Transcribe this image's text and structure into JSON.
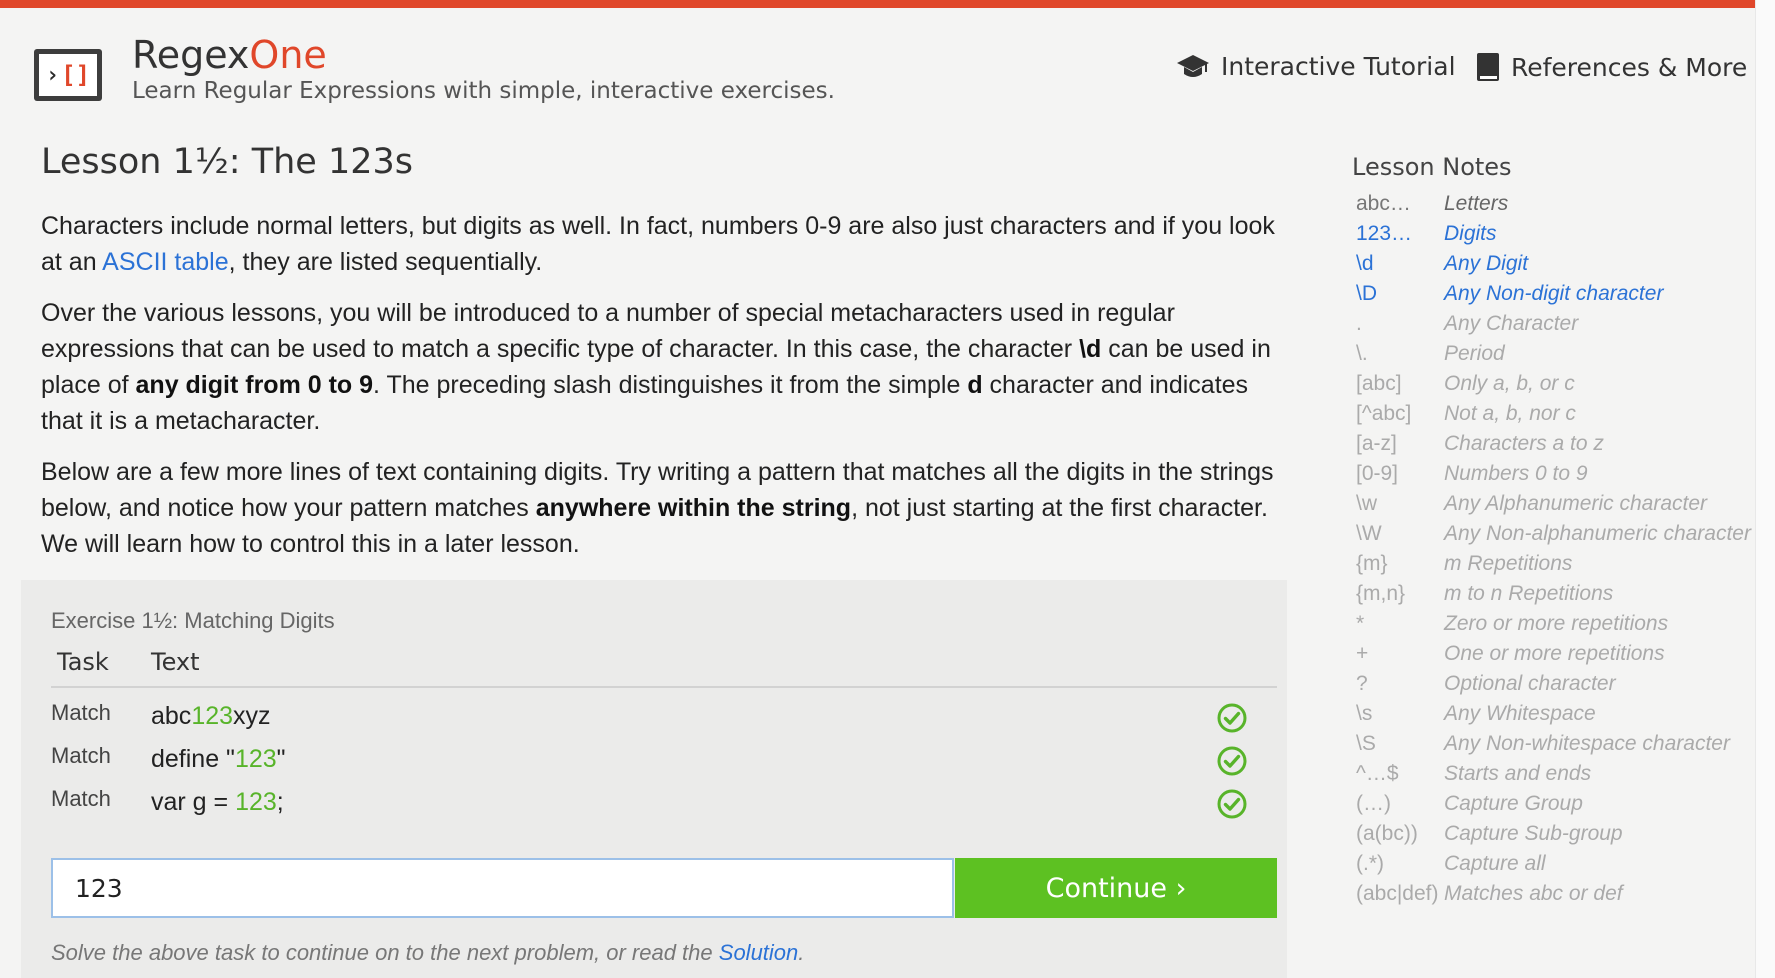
{
  "colors": {
    "accent": "#e0472a",
    "link": "#2b72d6",
    "success": "#5dc122",
    "match_text": "#58b42a"
  },
  "header": {
    "brand_regex": "Regex",
    "brand_one": "One",
    "tagline": "Learn Regular Expressions with simple, interactive exercises.",
    "nav": [
      {
        "label": "Interactive Tutorial",
        "icon": "graduation-cap-icon"
      },
      {
        "label": "References & More",
        "icon": "book-icon"
      }
    ]
  },
  "lesson": {
    "title": "Lesson 1½: The 123s",
    "p1": {
      "a": "Characters include normal letters, but digits as well. In fact, numbers 0-9 are also just characters and if you look at an ",
      "link": "ASCII table",
      "b": ", they are listed sequentially."
    },
    "p2": {
      "a": "Over the various lessons, you will be introduced to a number of special metacharacters used in regular expressions that can be used to match a specific type of character. In this case, the character ",
      "b1": "\\d",
      "b": " can be used in place of ",
      "b2": "any digit from 0 to 9",
      "c": ". The preceding slash distinguishes it from the simple ",
      "b3": "d",
      "d": " character and indicates that it is a metacharacter."
    },
    "p3": {
      "a": "Below are a few more lines of text containing digits. Try writing a pattern that matches all the digits in the strings below, and notice how your pattern matches ",
      "b1": "anywhere within the string",
      "b": ", not just starting at the first character. We will learn how to control this in a later lesson."
    }
  },
  "exercise": {
    "title": "Exercise 1½: Matching Digits",
    "headers": {
      "task": "Task",
      "text": "Text"
    },
    "rows": [
      {
        "task": "Match",
        "pre": "abc",
        "match": "123",
        "post": "xyz",
        "status": "check-circle-icon"
      },
      {
        "task": "Match",
        "pre": "define \"",
        "match": "123",
        "post": "\"",
        "status": "check-circle-icon"
      },
      {
        "task": "Match",
        "pre": "var g = ",
        "match": "123",
        "post": ";",
        "status": "check-circle-icon"
      }
    ],
    "input_value": "123",
    "continue_label": "Continue ›",
    "footnote_pre": "Solve the above task to continue on to the next problem, or read the ",
    "footnote_link": "Solution",
    "footnote_post": "."
  },
  "notes": {
    "title": "Lesson Notes",
    "items": [
      {
        "code": "abc…",
        "desc": "Letters",
        "state": "done"
      },
      {
        "code": "123…",
        "desc": "Digits",
        "state": "active"
      },
      {
        "code": "\\d",
        "desc": "Any Digit",
        "state": "active"
      },
      {
        "code": "\\D",
        "desc": "Any Non-digit character",
        "state": "active"
      },
      {
        "code": ".",
        "desc": "Any Character",
        "state": "future"
      },
      {
        "code": "\\.",
        "desc": "Period",
        "state": "future"
      },
      {
        "code": "[abc]",
        "desc": "Only a, b, or c",
        "state": "future"
      },
      {
        "code": "[^abc]",
        "desc": "Not a, b, nor c",
        "state": "future"
      },
      {
        "code": "[a-z]",
        "desc": "Characters a to z",
        "state": "future"
      },
      {
        "code": "[0-9]",
        "desc": "Numbers 0 to 9",
        "state": "future"
      },
      {
        "code": "\\w",
        "desc": "Any Alphanumeric character",
        "state": "future"
      },
      {
        "code": "\\W",
        "desc": "Any Non-alphanumeric character",
        "state": "future"
      },
      {
        "code": "{m}",
        "desc": "m Repetitions",
        "state": "future"
      },
      {
        "code": "{m,n}",
        "desc": "m to n Repetitions",
        "state": "future"
      },
      {
        "code": "*",
        "desc": "Zero or more repetitions",
        "state": "future"
      },
      {
        "code": "+",
        "desc": "One or more repetitions",
        "state": "future"
      },
      {
        "code": "?",
        "desc": "Optional character",
        "state": "future"
      },
      {
        "code": "\\s",
        "desc": "Any Whitespace",
        "state": "future"
      },
      {
        "code": "\\S",
        "desc": "Any Non-whitespace character",
        "state": "future"
      },
      {
        "code": "^…$",
        "desc": "Starts and ends",
        "state": "future"
      },
      {
        "code": "(…)",
        "desc": "Capture Group",
        "state": "future"
      },
      {
        "code": "(a(bc))",
        "desc": "Capture Sub-group",
        "state": "future"
      },
      {
        "code": "(.*)",
        "desc": "Capture all",
        "state": "future"
      },
      {
        "code": "(abc|def)",
        "desc": "Matches abc or def",
        "state": "future"
      }
    ]
  }
}
